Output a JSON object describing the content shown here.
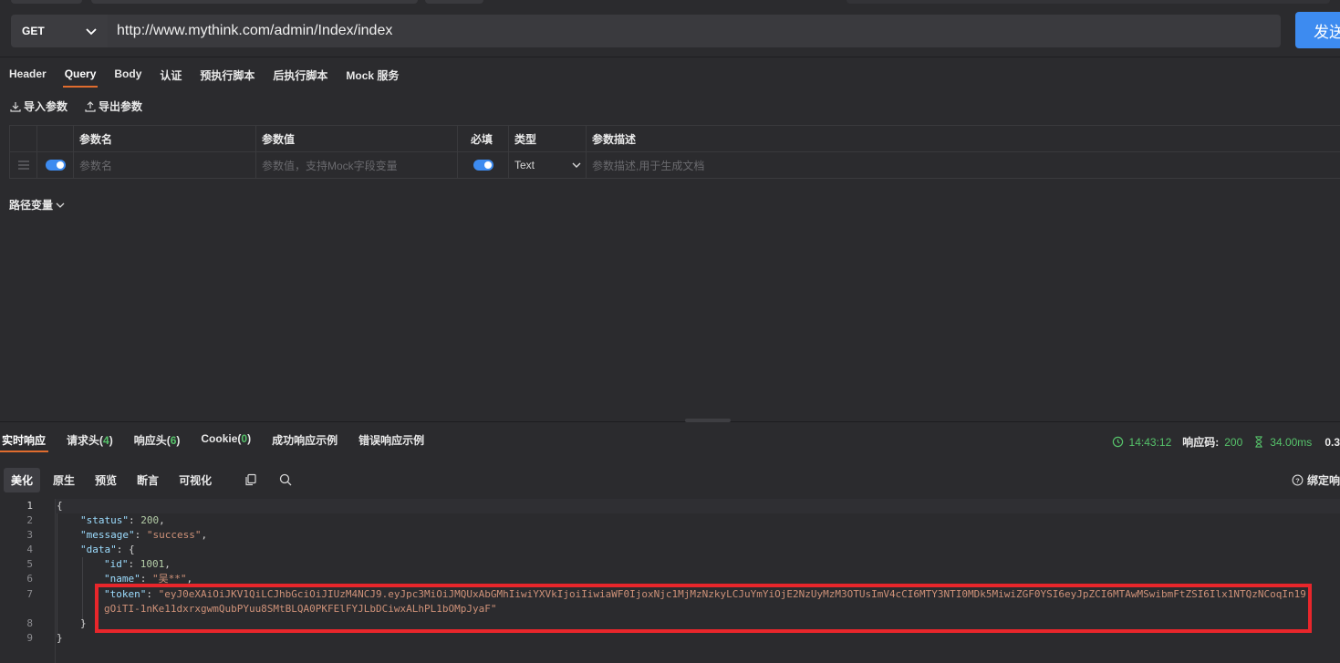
{
  "request": {
    "method": "GET",
    "url": "http://www.mythink.com/admin/Index/index",
    "send_label": "发送"
  },
  "req_tabs": [
    "Header",
    "Query",
    "Body",
    "认证",
    "预执行脚本",
    "后执行脚本",
    "Mock 服务"
  ],
  "param_actions": {
    "import": "导入参数",
    "export": "导出参数"
  },
  "param_table": {
    "headers": {
      "name": "参数名",
      "value": "参数值",
      "required": "必填",
      "type": "类型",
      "desc": "参数描述"
    },
    "row": {
      "name_placeholder": "参数名",
      "value_placeholder": "参数值，支持Mock字段变量",
      "type": "Text",
      "desc_placeholder": "参数描述,用于生成文档"
    }
  },
  "path_var_label": "路径变量",
  "response": {
    "tabs": {
      "live": "实时响应",
      "req_headers": "请求头(",
      "req_headers_count": "4",
      "resp_headers": "响应头(",
      "resp_headers_count": "6",
      "cookie": "Cookie(",
      "cookie_count": "0",
      "close_paren": ")",
      "success_example": "成功响应示例",
      "error_example": "错误响应示例"
    },
    "meta": {
      "time": "14:43:12",
      "code_label": "响应码:",
      "code": "200",
      "duration": "34.00ms",
      "size": "0.3"
    },
    "view_tabs": [
      "美化",
      "原生",
      "预览",
      "断言",
      "可视化"
    ],
    "bind_label": "绑定响"
  },
  "code": {
    "l1": "{",
    "k_status": "\"status\"",
    "v_status": "200",
    "k_message": "\"message\"",
    "v_message": "\"success\"",
    "k_data": "\"data\"",
    "k_id": "\"id\"",
    "v_id": "1001",
    "k_name": "\"name\"",
    "v_name": "\"吴**\"",
    "k_token": "\"token\"",
    "v_token_1": "\"eyJ0eXAiOiJKV1QiLCJhbGciOiJIUzM4NCJ9.eyJpc3MiOiJMQUxAbGMhIiwiYXVkIjoiIiwiaWF0IjoxNjc1MjMzNzkyLCJuYmYiOjE2NzUyMzM3OTUsImV4cCI6MTY3NTI0MDk5MiwiZGF0YSI6eyJpZCI6MTAwMSwibmFtZSI6Ilx1NTQzNCoqIn19.",
    "v_token_2": "gOiTI-1nKe11dxrxgwmQubPYuu8SMtBLQA0PKFElFYJLbDCiwxALhPL1bOMpJyaF\"",
    "close_data": "}",
    "close_root": "}"
  }
}
